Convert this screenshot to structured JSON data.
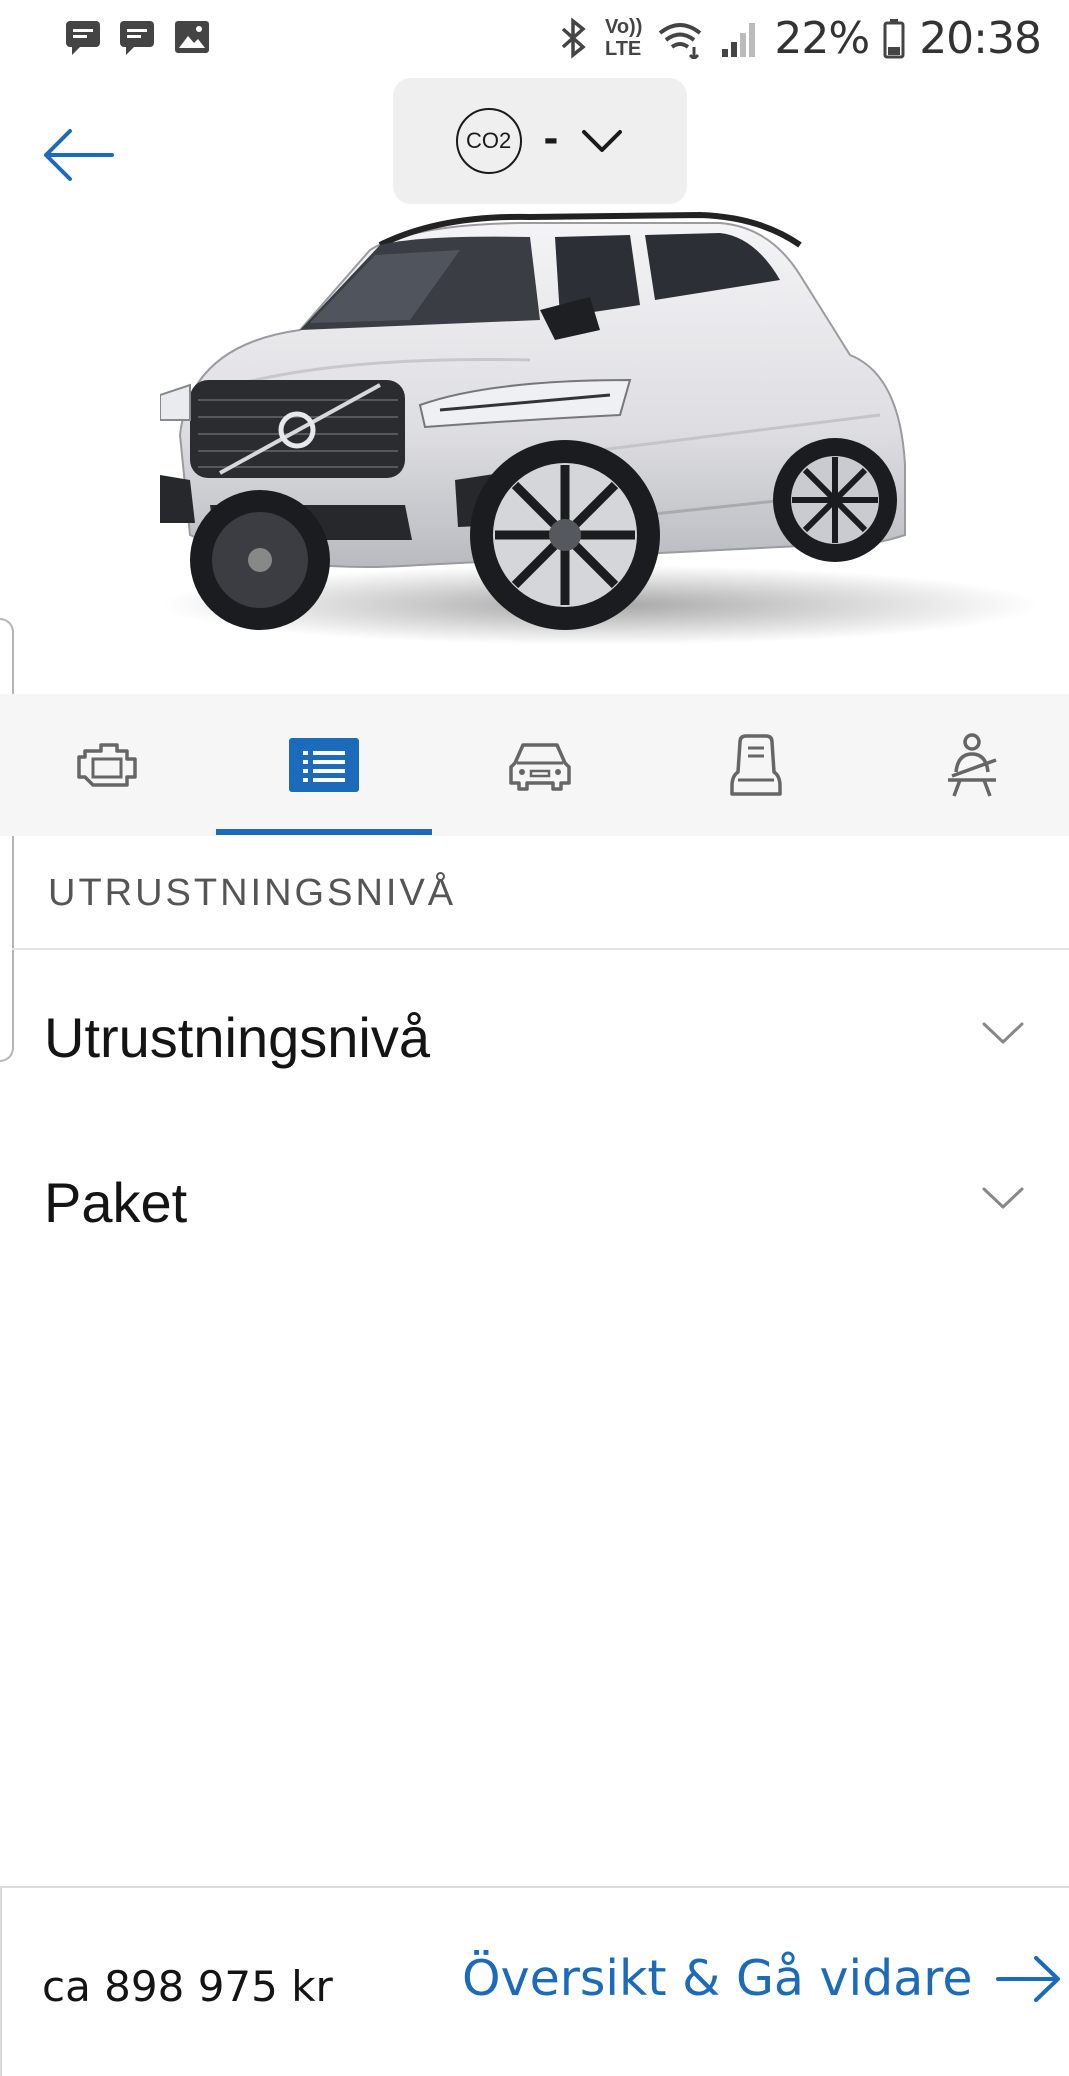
{
  "status_bar": {
    "left_icons": [
      "message-icon",
      "message-icon",
      "image-icon"
    ],
    "right_icons": [
      "bluetooth-icon",
      "volte-icon",
      "wifi-icon",
      "signal-icon",
      "battery-icon"
    ],
    "volte_label_top": "Vo))",
    "volte_label_bottom": "LTE",
    "battery": "22%",
    "time": "20:38"
  },
  "header": {
    "back_icon": "arrow-left-icon",
    "co2_badge": "CO2",
    "co2_value": "-",
    "dropdown_icon": "chevron-down-icon"
  },
  "tabs": [
    {
      "icon": "engine-icon",
      "active": false
    },
    {
      "icon": "list-icon",
      "active": true
    },
    {
      "icon": "car-front-icon",
      "active": false
    },
    {
      "icon": "seat-icon",
      "active": false
    },
    {
      "icon": "seatbelt-icon",
      "active": false
    }
  ],
  "section": {
    "label": "UTRUSTNINGSNIVÅ",
    "items": [
      {
        "title": "Utrustningsnivå"
      },
      {
        "title": "Paket"
      }
    ]
  },
  "footer": {
    "price": "ca 898 975 kr",
    "cta_label": "Översikt & Gå vidare",
    "cta_icon": "arrow-right-icon"
  },
  "colors": {
    "accent": "#1c6bba",
    "tab_bg": "#f6f6f6",
    "pill_bg": "#efefef"
  }
}
